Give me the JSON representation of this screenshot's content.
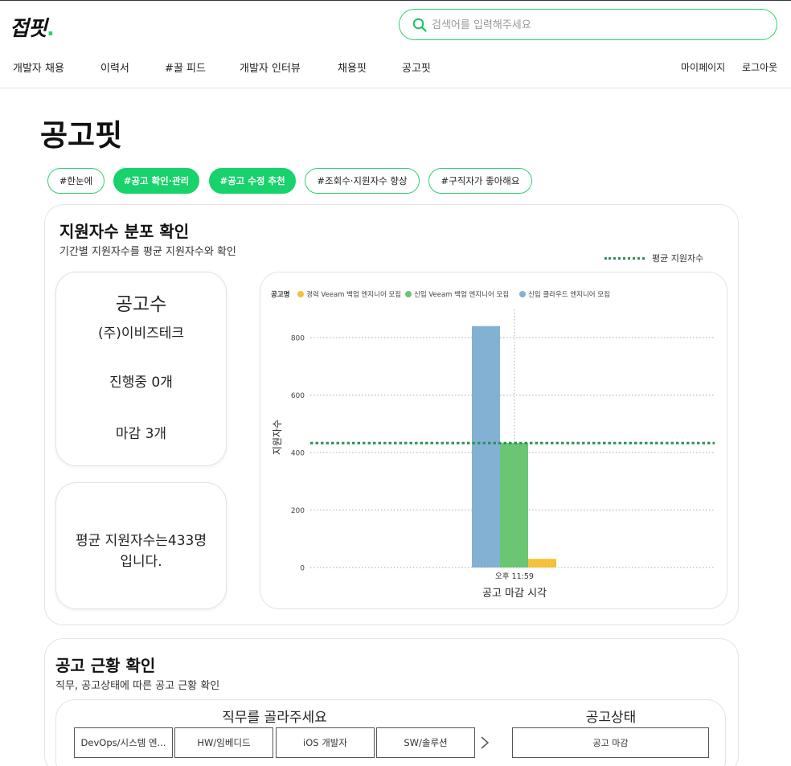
{
  "header": {
    "logo_text": "접핏",
    "logo_dot": ".",
    "search_placeholder": "검색어를 입력해주세요",
    "nav": [
      "개발자 채용",
      "이력서",
      "#꿀 피드",
      "개발자 인터뷰",
      "채용핏",
      "공고핏"
    ],
    "right_links": [
      "마이페이지",
      "로그아웃"
    ],
    "brand_color": "#2bd46b"
  },
  "page_title": "공고핏",
  "chips": [
    {
      "label": "#한눈에",
      "active": false
    },
    {
      "label": "#공고 확인·관리",
      "active": true
    },
    {
      "label": "#공고 수정 추천",
      "active": true
    },
    {
      "label": "#조회수·지원자수 향상",
      "active": false
    },
    {
      "label": "#구직자가 좋아해요",
      "active": false
    }
  ],
  "section1": {
    "title": "지원자수 분포 확인",
    "subtitle": "기간별 지원자수를 평균 지원자수와 확인",
    "avg_legend": "평균 지원자수",
    "card1": {
      "heading": "공고수",
      "company": "(주)이비즈테크",
      "ongoing": "진행중 0개",
      "closed": "마감 3개"
    },
    "card2": {
      "line1": "평균 지원자수는433명",
      "line2": "입니다."
    }
  },
  "chart_data": {
    "type": "bar",
    "legend_title": "공고명",
    "legend_position": "top-left",
    "categories": [
      "오후 11:59"
    ],
    "series": [
      {
        "name": "경력 Veeam 백업 엔지니어 모집",
        "color": "#f3c13a",
        "values": [
          30
        ]
      },
      {
        "name": "신입 Veeam 백업 엔지니어 모집",
        "color": "#6ac672",
        "values": [
          433
        ]
      },
      {
        "name": "신입 클라우드 엔지니어 모집",
        "color": "#82b1d4",
        "values": [
          840
        ]
      }
    ],
    "average_line": 433,
    "xlabel": "공고 마감 시각",
    "ylabel": "지원자수",
    "ylim": [
      0,
      900
    ],
    "yticks": [
      0,
      200,
      400,
      600,
      800
    ],
    "grid": true
  },
  "section2": {
    "title": "공고 근황 확인",
    "subtitle": "직무, 공고상태에 따른 공고 근황 확인",
    "job_label": "직무를 골라주세요",
    "jobs": [
      "DevOps/시스템 엔...",
      "HW/임베디드",
      "iOS 개발자",
      "SW/솔루션"
    ],
    "status_label": "공고상태",
    "status_value": "공고 마감"
  }
}
